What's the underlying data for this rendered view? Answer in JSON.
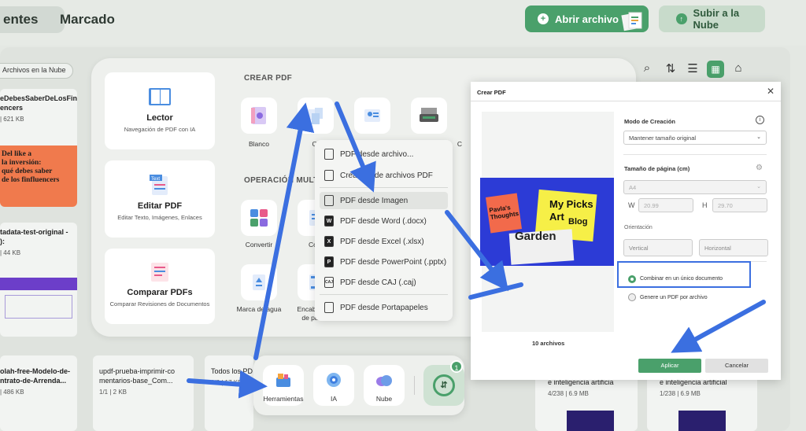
{
  "topbar": {
    "tab_recent": "entes",
    "tab_marked": "Marcado",
    "open_file": "Abrir archivo",
    "upload_cloud": "Subir a la Nube"
  },
  "background": {
    "cloud_tag": "Archivos en la Nube",
    "cards": [
      {
        "title": "eDebesSaberDeLosFin\nencers",
        "meta": "| 621 KB",
        "thumb_text": "Del like a\nla inversión:\nqué debes saber\nde los finfluencers"
      },
      {
        "title": "tadata-test-original -\n):",
        "meta": "| 44 KB"
      },
      {
        "title": "olah-free-Modelo-de-\nntrato-de-Arrenda...",
        "meta": "| 486 KB"
      },
      {
        "title": "updf-prueba-imprimir-co\nmentarios-base_Com...",
        "meta": "1/1 | 2 KB"
      },
      {
        "title": "Todos los PD",
        "meta": "1/6 | 17 KB"
      },
      {
        "title": "e inteligencia artificia",
        "meta": "4/238 | 6.9 MB"
      },
      {
        "title": "e inteligencia artificial",
        "meta": "1/238 | 6.9 MB"
      }
    ]
  },
  "panel": {
    "cards": [
      {
        "title": "Lector",
        "subtitle": "Navegación de PDF con IA"
      },
      {
        "title": "Editar PDF",
        "subtitle": "Editar Texto, Imágenes, Enlaces"
      },
      {
        "title": "Comparar PDFs",
        "subtitle": "Comparar Revisiones de Documentos"
      }
    ],
    "section_create": "CREAR PDF",
    "section_ops": "OPERACIÓN MULTI",
    "tools_create": [
      "Blanco",
      "Ot",
      "",
      "C"
    ],
    "tools_ops": [
      "Convertir",
      "Com",
      "Marca de agua",
      "Encabez\nde pa"
    ]
  },
  "menu": {
    "items": [
      "PDF desde archivo...",
      "Crear desde archivos PDF",
      "PDF desde Imagen",
      "PDF desde Word (.docx)",
      "PDF desde Excel (.xlsx)",
      "PDF desde PowerPoint (.pptx)",
      "PDF desde CAJ (.caj)",
      "PDF desde Portapapeles"
    ],
    "selected_index": 2
  },
  "dialog": {
    "title": "Crear PDF",
    "mode_label": "Modo de Creación",
    "mode_value": "Mantener tamaño original",
    "page_size_label": "Tamaño de página (cm)",
    "page_size_value": "A4",
    "w_label": "W",
    "w_value": "20.99",
    "h_label": "H",
    "h_value": "29.70",
    "orientation_label": "Orientación",
    "vertical": "Vertical",
    "horizontal": "Horizontal",
    "combine": "Combinar en un único documento",
    "per_file": "Genere un PDF por archivo",
    "file_count": "10 archivos",
    "apply": "Aplicar",
    "cancel": "Cancelar",
    "preview_text": [
      "Pavla's Thoughts",
      "My Picks",
      "Art",
      "Blog",
      "Garden"
    ]
  },
  "dock": {
    "tools": "Herramientas",
    "ai": "IA",
    "cloud": "Nube",
    "badge": "1"
  },
  "colors": {
    "accent": "#4aa06b",
    "arrow": "#3b6fe0",
    "highlight_border": "#3b6fe0"
  }
}
